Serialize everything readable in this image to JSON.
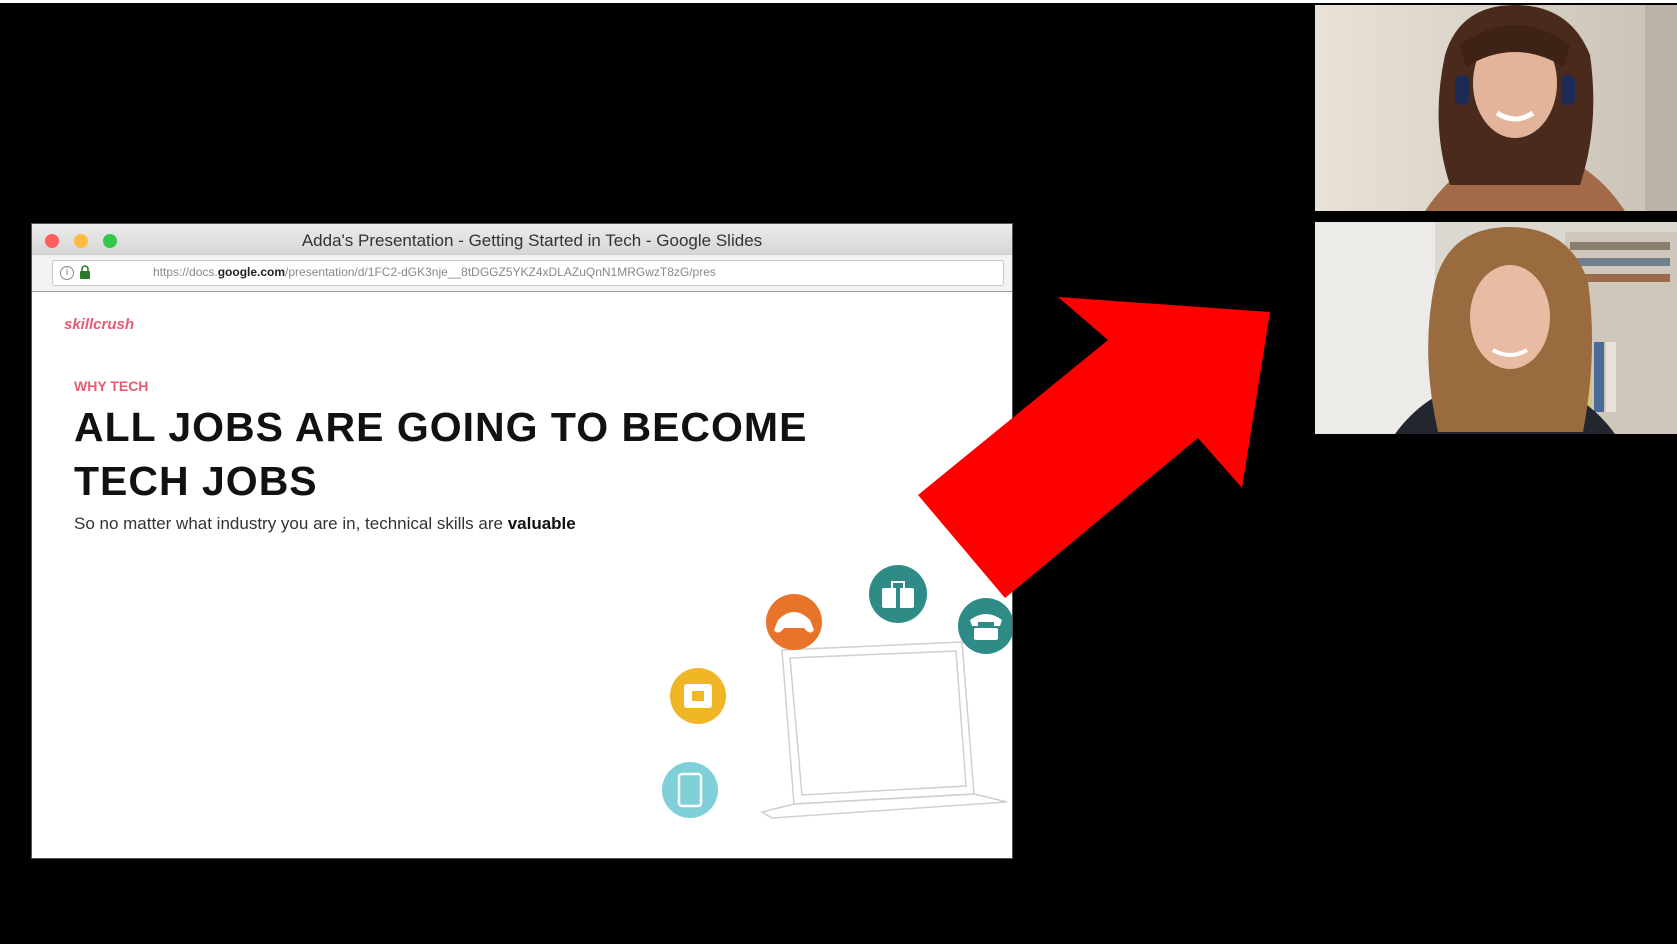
{
  "browser": {
    "window_title": "Adda's Presentation - Getting Started in Tech - Google Slides",
    "url_prefix": "https://docs.",
    "url_domain": "google.com",
    "url_suffix": "/presentation/d/1FC2-dGK3nje__8tDGGZ5YKZ4xDLAZuQnN1MRGwzT8zG/pres"
  },
  "slide": {
    "logo_text": "skillcrush",
    "eyebrow": "WHY TECH",
    "headline": "ALL JOBS ARE GOING TO BECOME TECH JOBS",
    "body_text": "So no matter what industry you are in, technical skills are ",
    "body_bold": "valuable",
    "illustration_icons": [
      "gamepad-icon",
      "briefcase-icon",
      "telephone-icon",
      "camera-icon",
      "tablet-icon",
      "laptop-icon"
    ]
  },
  "annotation": {
    "arrow_color": "#ff0000",
    "arrow_direction": "up-right"
  },
  "colors": {
    "background": "#000000",
    "icon_orange": "#e8742a",
    "icon_teal": "#2e8b86",
    "icon_yellow": "#f0b626",
    "icon_lightblue": "#7fd0d8",
    "slide_accent": "#e85a73"
  },
  "participants": [
    {
      "tile": "participant-video-1"
    },
    {
      "tile": "participant-video-2"
    }
  ]
}
